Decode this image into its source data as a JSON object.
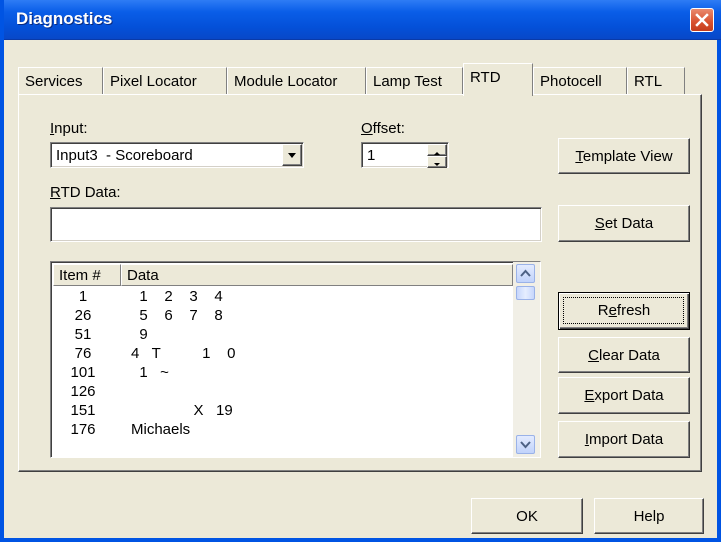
{
  "window": {
    "title": "Diagnostics"
  },
  "tabs": [
    {
      "label": "Services"
    },
    {
      "label": "Pixel Locator"
    },
    {
      "label": "Module Locator"
    },
    {
      "label": "Lamp Test"
    },
    {
      "label": "RTD"
    },
    {
      "label": "Photocell"
    },
    {
      "label": "RTL"
    }
  ],
  "active_tab": "RTD",
  "rtd": {
    "input_label_key": "I",
    "input_label_rest": "nput:",
    "input_value": "Input3  - Scoreboard",
    "offset_label_key": "O",
    "offset_label_rest": "ffset:",
    "offset_value": "1",
    "rtd_data_label_key": "R",
    "rtd_data_label_rest": "TD Data:",
    "rtd_data_value": ""
  },
  "list": {
    "headers": [
      "Item #",
      "Data"
    ],
    "rows": [
      {
        "item": "1",
        "data": "  1    2    3    4"
      },
      {
        "item": "26",
        "data": "  5    6    7    8"
      },
      {
        "item": "51",
        "data": "  9"
      },
      {
        "item": "76",
        "data": "4   T          1    0"
      },
      {
        "item": "101",
        "data": "  1   ~"
      },
      {
        "item": "126",
        "data": ""
      },
      {
        "item": "151",
        "data": "               X   19"
      },
      {
        "item": "176",
        "data": "Michaels"
      }
    ]
  },
  "buttons": {
    "template_view": {
      "key": "T",
      "rest": "emplate View"
    },
    "set_data": {
      "key": "S",
      "rest": "et Data"
    },
    "refresh": {
      "pre": "R",
      "key": "e",
      "rest": "fresh"
    },
    "clear_data": {
      "key": "C",
      "rest": "lear Data"
    },
    "export_data": {
      "key": "E",
      "rest": "xport Data"
    },
    "import_data": {
      "key": "I",
      "rest": "mport Data"
    },
    "ok": "OK",
    "help": "Help"
  }
}
